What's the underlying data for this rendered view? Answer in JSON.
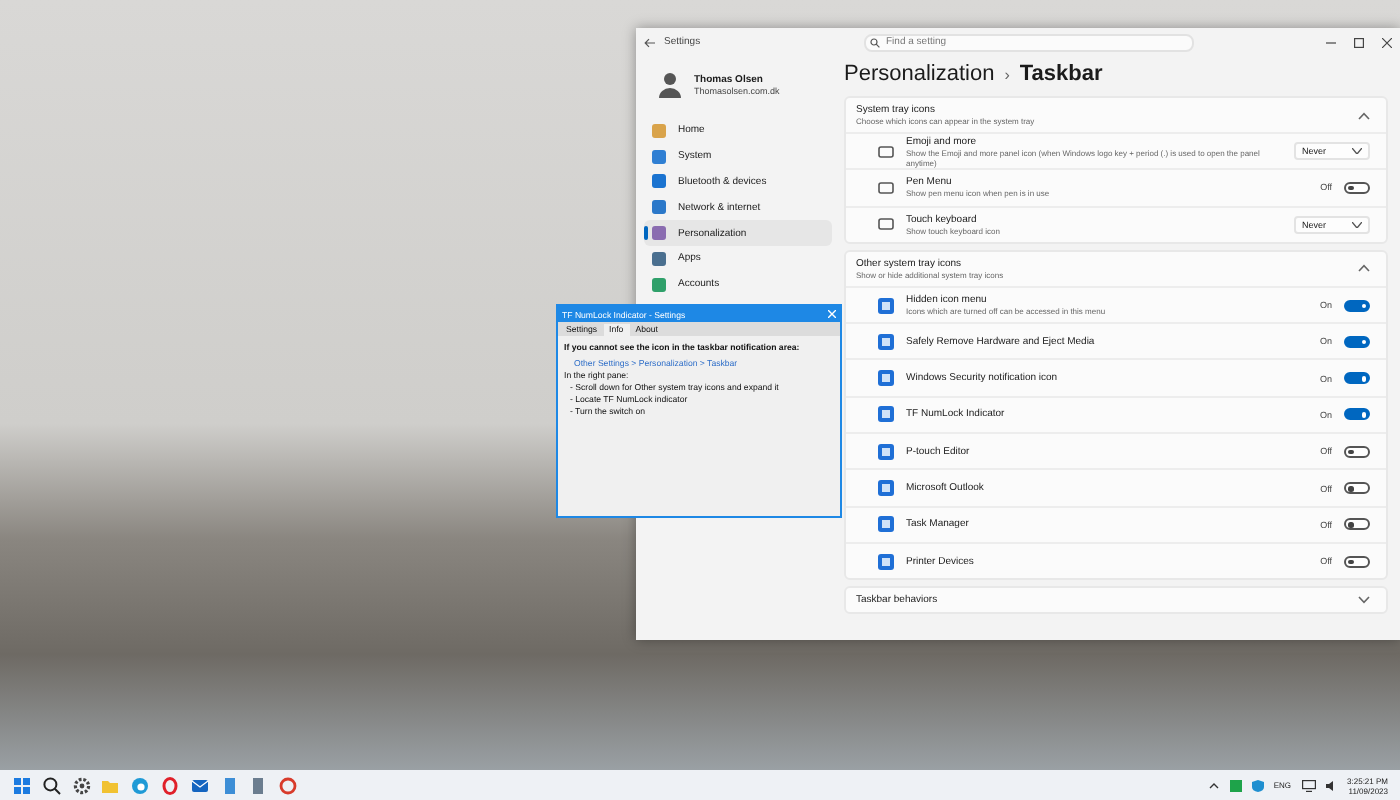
{
  "settings_window": {
    "title": "Settings",
    "search": {
      "placeholder": "Find a setting"
    },
    "user": {
      "name": "Thomas Olsen",
      "email": "Thomasolsen.com.dk"
    },
    "nav": [
      {
        "label": "Home",
        "selected": false
      },
      {
        "label": "System",
        "selected": false
      },
      {
        "label": "Bluetooth & devices",
        "selected": false
      },
      {
        "label": "Network & internet",
        "selected": false
      },
      {
        "label": "Personalization",
        "selected": true
      },
      {
        "label": "Apps",
        "selected": false
      },
      {
        "label": "Accounts",
        "selected": false
      }
    ],
    "breadcrumb": {
      "parent": "Personalization",
      "separator": "›",
      "current": "Taskbar"
    },
    "sections": [
      {
        "title": "System tray icons",
        "subtitle": "Choose which icons can appear in the system tray",
        "expanded": true,
        "rows": [
          {
            "kind": "dropdown",
            "label": "Emoji and more",
            "description": "Show the Emoji and more panel icon (when Windows logo key + period (.) is used to open the panel anytime)",
            "value": "Never"
          },
          {
            "kind": "toggle",
            "label": "Pen Menu",
            "description": "Show pen menu icon when pen is in use",
            "on": false,
            "state_text": "Off"
          },
          {
            "kind": "dropdown",
            "label": "Touch keyboard",
            "description": "Show touch keyboard icon",
            "value": "Never"
          }
        ]
      },
      {
        "title": "Other system tray icons",
        "subtitle": "Show or hide additional system tray icons",
        "expanded": true,
        "rows": [
          {
            "kind": "toggle",
            "label": "Hidden icon menu",
            "description": "Icons which are turned off can be accessed in this menu",
            "on": true,
            "state_text": "On"
          },
          {
            "kind": "toggle",
            "label": "Safely Remove Hardware and Eject Media",
            "on": true,
            "state_text": "On"
          },
          {
            "kind": "toggle",
            "label": "Windows Security notification icon",
            "on": true,
            "state_text": "On"
          },
          {
            "kind": "toggle",
            "label": "TF NumLock Indicator",
            "on": true,
            "state_text": "On"
          },
          {
            "kind": "toggle",
            "label": "P-touch Editor",
            "on": false,
            "state_text": "Off"
          },
          {
            "kind": "toggle",
            "label": "Microsoft Outlook",
            "on": false,
            "state_text": "Off"
          },
          {
            "kind": "toggle",
            "label": "Task Manager",
            "on": false,
            "state_text": "Off"
          },
          {
            "kind": "toggle",
            "label": "Printer Devices",
            "on": false,
            "state_text": "Off"
          }
        ]
      },
      {
        "title": "Taskbar behaviors",
        "expanded": false
      }
    ]
  },
  "dialog": {
    "title": "TF NumLock Indicator - Settings",
    "tabs": [
      {
        "label": "Settings",
        "selected": false
      },
      {
        "label": "Info",
        "selected": true
      },
      {
        "label": "About",
        "selected": false
      }
    ],
    "heading": "If you cannot see the icon in the taskbar notification area:",
    "link": "Other Settings > Personalization > Taskbar",
    "lines": [
      "In the right pane:",
      "- Scroll down for Other system tray icons and expand it",
      "- Locate TF NumLock indicator",
      "- Turn the switch on"
    ]
  },
  "taskbar": {
    "language": "ENG",
    "time": "3:25:21 PM",
    "date": "11/09/2023"
  }
}
